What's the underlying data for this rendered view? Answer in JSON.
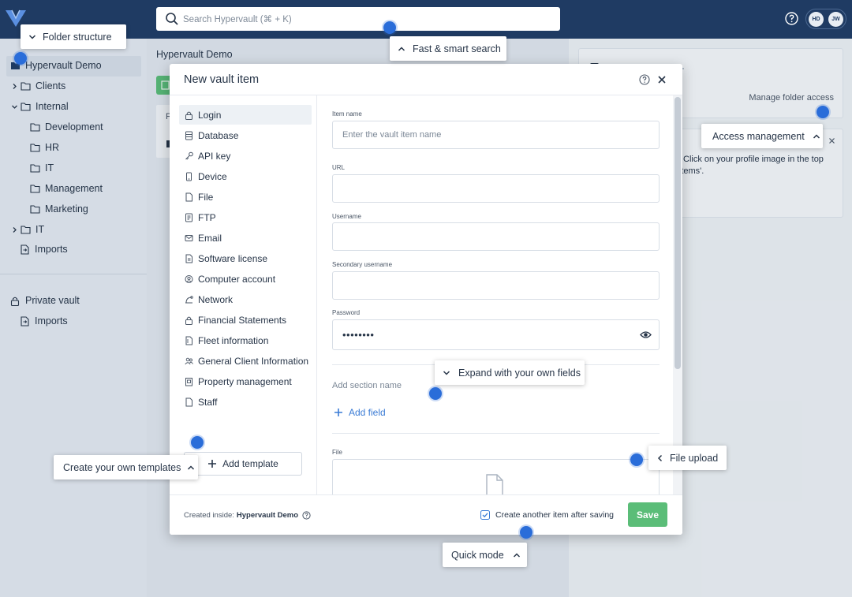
{
  "topbar": {
    "search_placeholder": "Search Hypervault (⌘ + K)",
    "avatars": [
      {
        "initials": "HD",
        "bg": "#e8edf3",
        "fg": "#1f3b63"
      },
      {
        "initials": "JW",
        "bg": "#e8edf3",
        "fg": "#1f3b63"
      }
    ]
  },
  "sidebar": {
    "root": "Hypervault Demo",
    "folders": [
      {
        "label": "Clients"
      },
      {
        "label": "Internal"
      },
      {
        "label": "Development"
      },
      {
        "label": "HR"
      },
      {
        "label": "IT"
      },
      {
        "label": "Management"
      },
      {
        "label": "Marketing"
      },
      {
        "label": "IT"
      },
      {
        "label": "Imports"
      }
    ],
    "private_vault": "Private vault",
    "private_imports": "Imports"
  },
  "main": {
    "breadcrumb": "Hypervault Demo",
    "col_initial": "F"
  },
  "right": {
    "manage_folder_access": "Manage folder access",
    "tip_line1": "Click on your profile image in the top",
    "tip_line2": "ort items'."
  },
  "modal": {
    "title": "New vault item",
    "templates": [
      {
        "label": "Login",
        "icon": "lock-icon"
      },
      {
        "label": "Database",
        "icon": "database-icon"
      },
      {
        "label": "API key",
        "icon": "key-icon"
      },
      {
        "label": "Device",
        "icon": "device-icon"
      },
      {
        "label": "File",
        "icon": "file-icon"
      },
      {
        "label": "FTP",
        "icon": "ftp-icon"
      },
      {
        "label": "Email",
        "icon": "email-icon"
      },
      {
        "label": "Software license",
        "icon": "license-icon"
      },
      {
        "label": "Computer account",
        "icon": "account-icon"
      },
      {
        "label": "Network",
        "icon": "network-icon"
      },
      {
        "label": "Financial Statements",
        "icon": "lock-icon"
      },
      {
        "label": "Fleet information",
        "icon": "file-icon"
      },
      {
        "label": "General Client Information",
        "icon": "people-icon"
      },
      {
        "label": "Property management",
        "icon": "building-icon"
      },
      {
        "label": "Staff",
        "icon": "file-icon"
      }
    ],
    "add_template": "Add template",
    "form": {
      "item_name_label": "Item name",
      "item_name_placeholder": "Enter the vault item name",
      "url_label": "URL",
      "username_label": "Username",
      "secondary_username_label": "Secondary username",
      "password_label": "Password",
      "password_value": "••••••••",
      "add_section_name": "Add section name",
      "add_field": "Add field",
      "file_label": "File"
    },
    "footer": {
      "created_inside_label": "Created inside:",
      "created_inside_value": "Hypervault Demo",
      "create_another": "Create another item after saving",
      "create_another_checked": true,
      "save": "Save"
    }
  },
  "tour": {
    "folder_structure": "Folder structure",
    "fast_search": "Fast & smart search",
    "access_management": "Access management",
    "expand_fields": "Expand with your own fields",
    "create_templates": "Create your own templates",
    "file_upload": "File upload",
    "quick_mode": "Quick mode"
  },
  "colors": {
    "topbar": "#1f3b63",
    "accent_dot": "#2a6dd9",
    "save": "#5bbd78",
    "add_field": "#3a7bd5"
  }
}
